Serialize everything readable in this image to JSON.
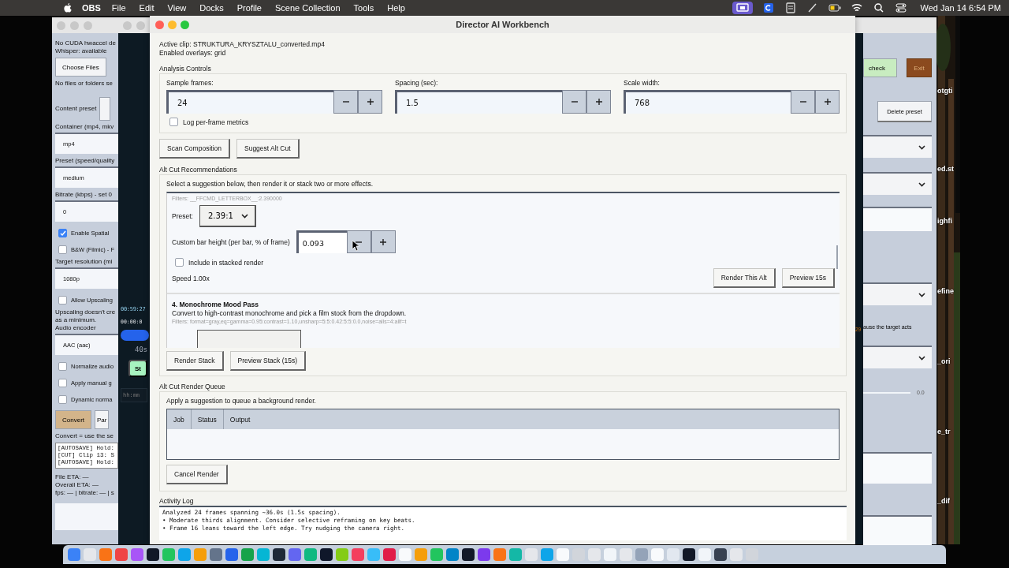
{
  "menu_bar": {
    "app_name": "OBS",
    "menus": [
      "File",
      "Edit",
      "View",
      "Docks",
      "Profile",
      "Scene Collection",
      "Tools",
      "Help"
    ],
    "clock": "Wed Jan 14  6:54 PM"
  },
  "converter_window": {
    "items": [
      {
        "kind": "text",
        "text": "No CUDA hwaccel de"
      },
      {
        "kind": "text",
        "text": "Whisper: available"
      },
      {
        "kind": "button",
        "text": "Choose Files"
      },
      {
        "kind": "text",
        "text": "No files or folders se"
      },
      {
        "kind": "select",
        "text": "Content preset"
      },
      {
        "kind": "label",
        "text": "Container (mp4, mkv"
      },
      {
        "kind": "field",
        "text": "mp4"
      },
      {
        "kind": "label",
        "text": "Preset (speed/quality"
      },
      {
        "kind": "field",
        "text": "medium"
      },
      {
        "kind": "label",
        "text": "Bitrate (kbps) - set 0"
      },
      {
        "kind": "field",
        "text": "0"
      },
      {
        "kind": "checkbox",
        "text": "Enable Spatial",
        "checked": true
      },
      {
        "kind": "checkbox",
        "text": "B&W (Filmic) - F",
        "checked": false
      },
      {
        "kind": "label",
        "text": "Target resolution (mi"
      },
      {
        "kind": "field",
        "text": "1080p"
      },
      {
        "kind": "checkbox",
        "text": "Allow Upscaling",
        "checked": false
      },
      {
        "kind": "text",
        "text": "Upscaling doesn't cre"
      },
      {
        "kind": "text",
        "text": "as a minimum."
      },
      {
        "kind": "text",
        "text": "Audio encoder"
      },
      {
        "kind": "field",
        "text": "AAC (aac)"
      },
      {
        "kind": "checkbox",
        "text": "Normalize audio",
        "checked": false
      },
      {
        "kind": "checkbox",
        "text": "Apply manual g",
        "checked": false
      },
      {
        "kind": "checkbox",
        "text": "Dynamic norma",
        "checked": false
      },
      {
        "kind": "buttons",
        "buttons": [
          {
            "text": "Convert",
            "primary": true
          },
          {
            "text": "Par",
            "primary": false
          }
        ]
      },
      {
        "kind": "text",
        "text": "Convert = use the se"
      },
      {
        "kind": "log",
        "lines": [
          "[AUTOSAVE] Hold:",
          "[CUT] Clip 13: S",
          "[AUTOSAVE] Hold:"
        ]
      },
      {
        "kind": "text",
        "text": "File ETA: —"
      },
      {
        "kind": "text",
        "text": "Overall ETA: —"
      },
      {
        "kind": "text",
        "text": "fps: — | bitrate: — | s"
      },
      {
        "kind": "empty_field"
      }
    ],
    "right_side": {
      "check_button": "check",
      "exit_button": "Exit",
      "delete_button": "Delete preset",
      "note": "ause the target acts",
      "slider_value": "0.0"
    }
  },
  "video_window": {
    "timecode": "00:59:27",
    "position": "00:00:0",
    "duration": "40s",
    "start_button": "St",
    "time_placeholder": "hh:mm",
    "marker": "29"
  },
  "workbench": {
    "title": "Director AI Workbench",
    "active_clip": "Active clip: STRUKTURA_KRYSZTALU_converted.mp4",
    "overlays": "Enabled overlays: grid",
    "analysis_controls": {
      "title": "Analysis Controls",
      "spinners": [
        {
          "label": "Sample frames:",
          "value": "24"
        },
        {
          "label": "Spacing (sec):",
          "value": "1.5"
        },
        {
          "label": "Scale width:",
          "value": "768"
        }
      ],
      "log_metrics": {
        "label": "Log per-frame metrics",
        "checked": false
      }
    },
    "actions": [
      "Scan Composition",
      "Suggest Alt Cut"
    ],
    "recommendations": {
      "title": "Alt Cut Recommendations",
      "hint": "Select a suggestion below, then render it or stack two or more effects.",
      "cards": [
        {
          "kind": "letterbox",
          "filters": "Filters: __FFCMD_LETTERBOX__:2.390000",
          "preset_label": "Preset:",
          "preset": "2.39:1",
          "bar_label": "Custom bar height (per bar, % of frame)",
          "bar_value": "0.093",
          "include_label": "Include in stacked render",
          "include": false,
          "speed": "Speed 1.00x",
          "buttons": [
            "Render This Alt",
            "Preview 15s"
          ]
        },
        {
          "kind": "mono",
          "title": "4. Monochrome Mood Pass",
          "description": "Convert to high-contrast monochrome and pick a film stock from the dropdown.",
          "filters": "Filters: format=gray,eq=gamma=0.95:contrast=1.10,unsharp=5:5:0.42:5:5:0.0,noise=alls=4:allf=t"
        }
      ],
      "stack_buttons": [
        "Render Stack",
        "Preview Stack (15s)"
      ]
    },
    "render_queue": {
      "title": "Alt Cut Render Queue",
      "hint": "Apply a suggestion to queue a background render.",
      "columns": [
        "Job",
        "Status",
        "Output"
      ],
      "cancel": "Cancel Render"
    },
    "activity_log": {
      "title": "Activity Log",
      "lines": [
        "Analyzed 24 frames spanning ~36.0s (1.5s spacing).",
        "• Moderate thirds alignment. Consider selective reframing on key beats.",
        "• Frame 16 leans toward the left edge. Try nudging the camera right."
      ]
    }
  },
  "desktop_labels": [
    "otgti",
    "ed.st",
    "ighfi",
    "efine",
    "_ori",
    "e_tr",
    "_dif"
  ]
}
